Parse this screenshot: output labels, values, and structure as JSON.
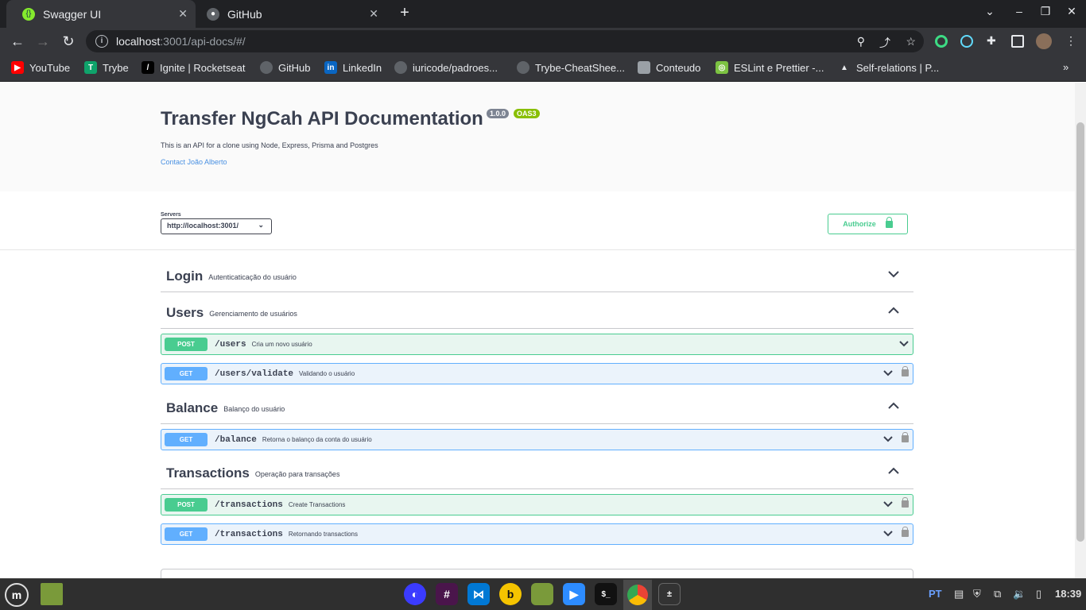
{
  "tabs": [
    {
      "title": "Swagger UI",
      "active": true,
      "favicon": "swagger-icon"
    },
    {
      "title": "GitHub",
      "active": false,
      "favicon": "github-icon"
    }
  ],
  "address_bar": {
    "host": "localhost",
    "rest": ":3001/api-docs/#/"
  },
  "bookmarks": [
    "YouTube",
    "Trybe",
    "Ignite | Rocketseat",
    "GitHub",
    "LinkedIn",
    "iuricode/padroes...",
    "Trybe-CheatShee...",
    "Conteudo",
    "ESLint e Prettier -...",
    "Self-relations | P..."
  ],
  "api": {
    "title": "Transfer NgCah API Documentation",
    "version": "1.0.0",
    "spec": "OAS3",
    "description": "This is an API for a clone using Node, Express, Prisma and Postgres",
    "contact": "Contact João Alberto"
  },
  "servers": {
    "label": "Servers",
    "selected": "http://localhost:3001/"
  },
  "authorize_label": "Authorize",
  "tags": [
    {
      "name": "Login",
      "description": "Autenticaticação do usuário",
      "expanded": false,
      "operations": []
    },
    {
      "name": "Users",
      "description": "Gerenciamento de usuários",
      "expanded": true,
      "operations": [
        {
          "method": "POST",
          "path": "/users",
          "summary": "Cria um novo usuário",
          "locked": false
        },
        {
          "method": "GET",
          "path": "/users/validate",
          "summary": "Validando o usuário",
          "locked": true
        }
      ]
    },
    {
      "name": "Balance",
      "description": "Balanço do usuário",
      "expanded": true,
      "operations": [
        {
          "method": "GET",
          "path": "/balance",
          "summary": "Retorna o balanço da conta do usuário",
          "locked": true
        }
      ]
    },
    {
      "name": "Transactions",
      "description": "Operação para transações",
      "expanded": true,
      "operations": [
        {
          "method": "POST",
          "path": "/transactions",
          "summary": "Create Transactions",
          "locked": true
        },
        {
          "method": "GET",
          "path": "/transactions",
          "summary": "Retornando transactions",
          "locked": true
        }
      ]
    }
  ],
  "taskbar": {
    "lang": "PT",
    "time": "18:39"
  },
  "colors": {
    "post": "#49cc90",
    "get": "#61affe",
    "text": "#3b4151",
    "link": "#4990e2"
  }
}
